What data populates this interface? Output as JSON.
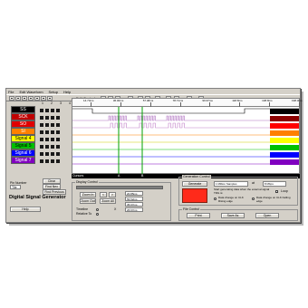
{
  "menu": [
    "File",
    "Edit Waveform",
    "Setup",
    "Help"
  ],
  "toolbar": {
    "edit_control_label": "Edit Control"
  },
  "column_numbers": [
    "1",
    "2",
    "3",
    "4"
  ],
  "signals": [
    {
      "label": "SS",
      "bg": "#000000",
      "fg": "#ffffff",
      "swatch": "#000000"
    },
    {
      "label": "SCK",
      "bg": "#c00000",
      "fg": "#ffffff",
      "swatch": "#8b0000"
    },
    {
      "label": "SO",
      "bg": "#e00000",
      "fg": "#ffffff",
      "swatch": "#ff0000"
    },
    {
      "label": "SI",
      "bg": "#ff8000",
      "fg": "#ffffff",
      "swatch": "#ff8000"
    },
    {
      "label": "Signal 4",
      "bg": "#ffff00",
      "fg": "#000000",
      "swatch": "#ffff00"
    },
    {
      "label": "Signal 5",
      "bg": "#00c000",
      "fg": "#000000",
      "swatch": "#00c000"
    },
    {
      "label": "Signal 6",
      "bg": "#0000ff",
      "fg": "#ffffff",
      "swatch": "#0000ff"
    },
    {
      "label": "Signal 7",
      "bg": "#8000c0",
      "fg": "#ffffff",
      "swatch": "#8000c0"
    }
  ],
  "ruler_labels": [
    "14.74ms",
    "36.00ms",
    "57.48ms",
    "78.71ms",
    "99.97ms",
    "118.8ms",
    "138.8ms",
    "198.3ms"
  ],
  "cursors": {
    "label": "Cursors",
    "a": "A",
    "b": "B"
  },
  "pins": {
    "label": "Pin Number",
    "value": "Tile"
  },
  "buttons": {
    "clear": "Clear",
    "find_next": "Find Nex",
    "find_previous": "Find Previous",
    "zoom_in": "Zoom In",
    "zoom_out": "Zoom Out",
    "zoom_all": "Zoom All",
    "generate": "Generate",
    "print": "Print",
    "save_as": "Save As",
    "open": "Open",
    "help": "Help"
  },
  "app_title": "Digital Signal Generator",
  "display_control": {
    "title": "Display Control",
    "timeline_label": "Timeline",
    "relative_label": "Relative To",
    "field_a": "20.85ms",
    "field_b": "56.52ms",
    "field_c": "35.67ms",
    "field_x": "26.67ms"
  },
  "generation_control": {
    "title": "Generation Control",
    "samples": "1 Million Samples",
    "rate_label": "at",
    "rate": "8 Mbps",
    "start_text": "Start generating data when the external signal TRG is:",
    "loop_label": "Loop",
    "rising": "Data change on CLK Rising edge",
    "falling": "Data change on CLK Falling edge"
  },
  "file_control": {
    "title": "File Control"
  },
  "colors": {
    "window": "#d4d0c8",
    "accent_red": "#ff2a1a",
    "wave_purple": "#b070c0"
  }
}
